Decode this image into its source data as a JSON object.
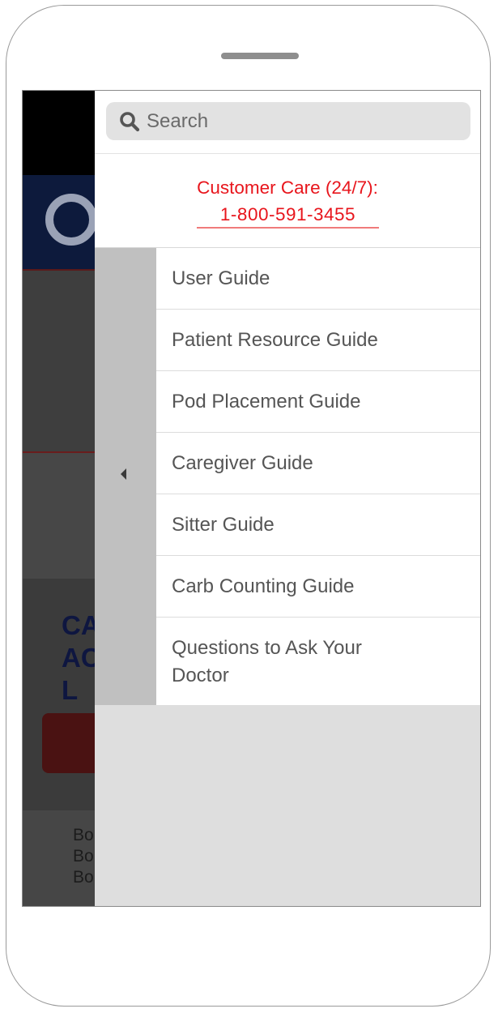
{
  "search": {
    "placeholder": "Search"
  },
  "customer_care": {
    "title": "Customer Care (24/7):",
    "phone": "1-800-591-3455"
  },
  "menu": {
    "items": [
      {
        "label": "User Guide"
      },
      {
        "label": "Patient Resource Guide"
      },
      {
        "label": "Pod Placement Guide"
      },
      {
        "label": "Caregiver Guide"
      },
      {
        "label": "Sitter Guide"
      },
      {
        "label": "Carb Counting Guide"
      },
      {
        "label": "Questions to Ask Your Doctor"
      }
    ]
  },
  "background_page": {
    "heading_lines": [
      "CA",
      "AC",
      "L"
    ],
    "body_lines": [
      "Bo",
      "Bo",
      "Bo"
    ]
  },
  "icons": {
    "search": "search-icon",
    "collapse": "chevron-left-icon"
  },
  "colors": {
    "care_text": "#e8151c",
    "drawer_bg": "#dedede",
    "handle_bg": "#c0c0c0",
    "menu_text": "#555555"
  }
}
